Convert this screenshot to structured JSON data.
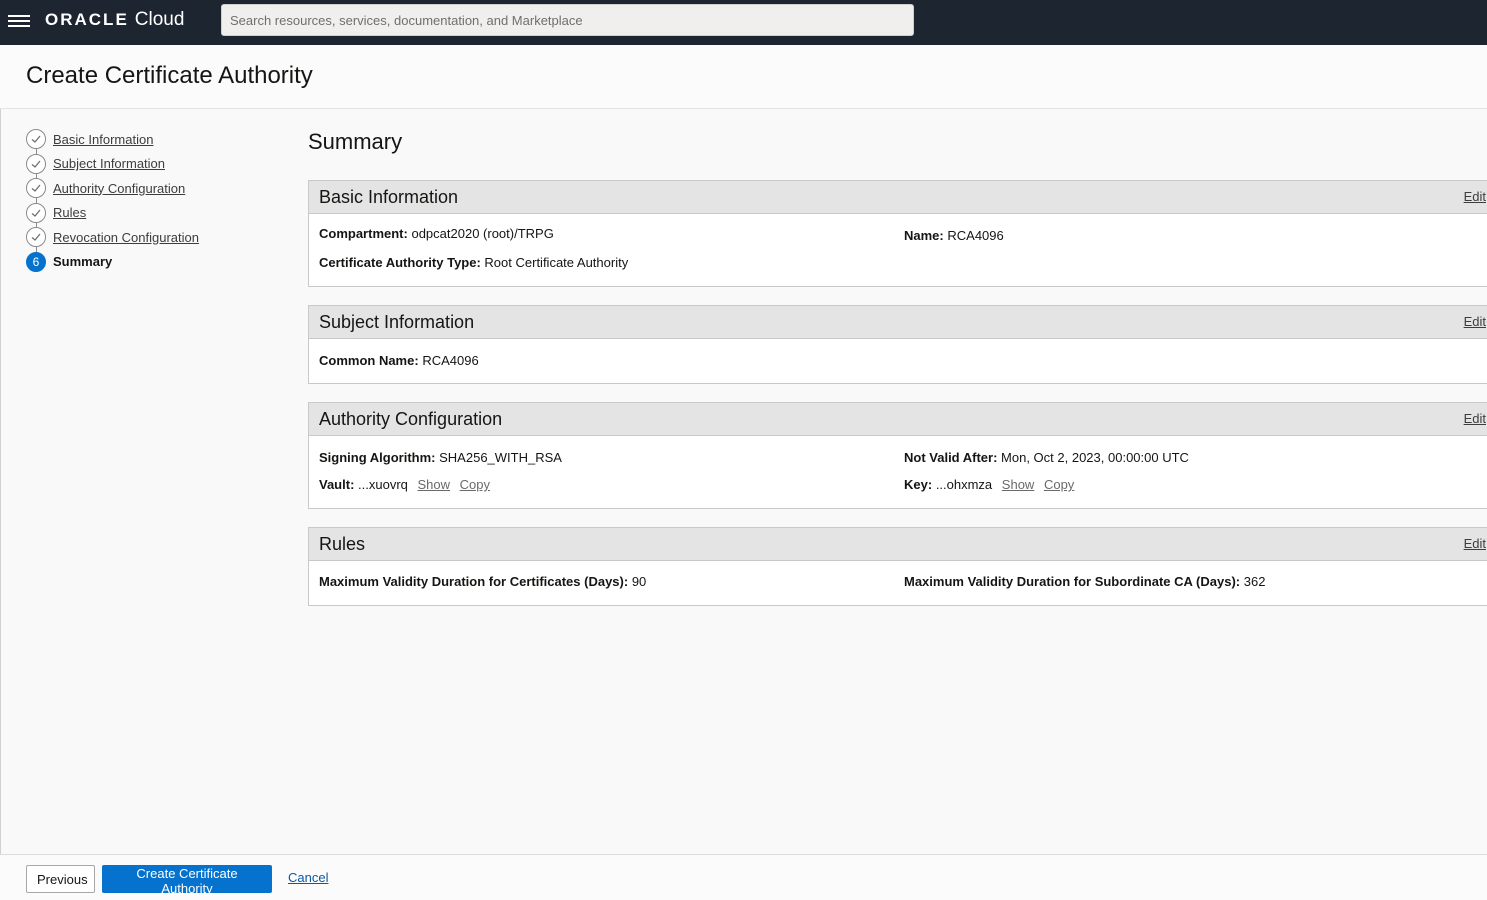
{
  "topbar": {
    "logo_oracle": "ORACLE",
    "logo_cloud": "Cloud",
    "search_placeholder": "Search resources, services, documentation, and Marketplace"
  },
  "page": {
    "title": "Create Certificate Authority",
    "summary_title": "Summary"
  },
  "steps": [
    {
      "label": "Basic Information",
      "state": "complete"
    },
    {
      "label": "Subject Information",
      "state": "complete"
    },
    {
      "label": "Authority Configuration",
      "state": "complete"
    },
    {
      "label": "Rules",
      "state": "complete"
    },
    {
      "label": "Revocation Configuration",
      "state": "complete"
    },
    {
      "label": "Summary",
      "state": "current",
      "number": "6"
    }
  ],
  "sections": {
    "basic": {
      "title": "Basic Information",
      "edit": "Edit",
      "compartment_label": "Compartment:",
      "compartment_value": "odpcat2020 (root)/TRPG",
      "name_label": "Name:",
      "name_value": "RCA4096",
      "type_label": "Certificate Authority Type:",
      "type_value": "Root Certificate Authority"
    },
    "subject": {
      "title": "Subject Information",
      "edit": "Edit",
      "cn_label": "Common Name:",
      "cn_value": "RCA4096"
    },
    "authority": {
      "title": "Authority Configuration",
      "edit": "Edit",
      "alg_label": "Signing Algorithm:",
      "alg_value": "SHA256_WITH_RSA",
      "nva_label": "Not Valid After:",
      "nva_value": "Mon, Oct 2, 2023, 00:00:00 UTC",
      "vault_label": "Vault:",
      "vault_value": "...xuovrq",
      "key_label": "Key:",
      "key_value": "...ohxmza",
      "show": "Show",
      "copy": "Copy"
    },
    "rules": {
      "title": "Rules",
      "edit": "Edit",
      "max_cert_label": "Maximum Validity Duration for Certificates (Days):",
      "max_cert_value": "90",
      "max_sub_label": "Maximum Validity Duration for Subordinate CA (Days):",
      "max_sub_value": "362"
    }
  },
  "footer": {
    "previous": "Previous",
    "create": "Create Certificate Authority",
    "cancel": "Cancel"
  }
}
